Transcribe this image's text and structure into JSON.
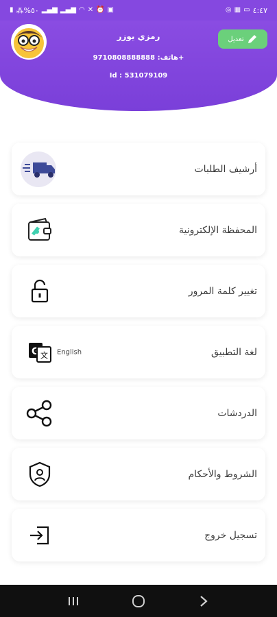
{
  "status_bar": {
    "left_text": "⁂%٥٠",
    "time": "٤:٤٧"
  },
  "profile": {
    "edit_label": "تعديل",
    "name": "رمزي يوزر",
    "phone": "هاتف: 9710808888888+",
    "id_text": "Id : 531079109"
  },
  "menu": [
    {
      "label": "أرشيف الطلبات",
      "icon": "truck-icon"
    },
    {
      "label": "المحفظة الإلكترونية",
      "icon": "wallet-icon"
    },
    {
      "label": "تغيير كلمة المرور",
      "icon": "lock-icon"
    },
    {
      "label": "لغة التطبيق",
      "icon": "translate-icon",
      "sub": "English"
    },
    {
      "label": "الدردشات",
      "icon": "share-icon"
    },
    {
      "label": "الشروط والأحكام",
      "icon": "shield-user-icon"
    },
    {
      "label": "تسجيل خروج",
      "icon": "logout-icon"
    }
  ],
  "colors": {
    "header": "#8548e0",
    "edit_button": "#6bd07b",
    "nav_bar": "#101010"
  }
}
